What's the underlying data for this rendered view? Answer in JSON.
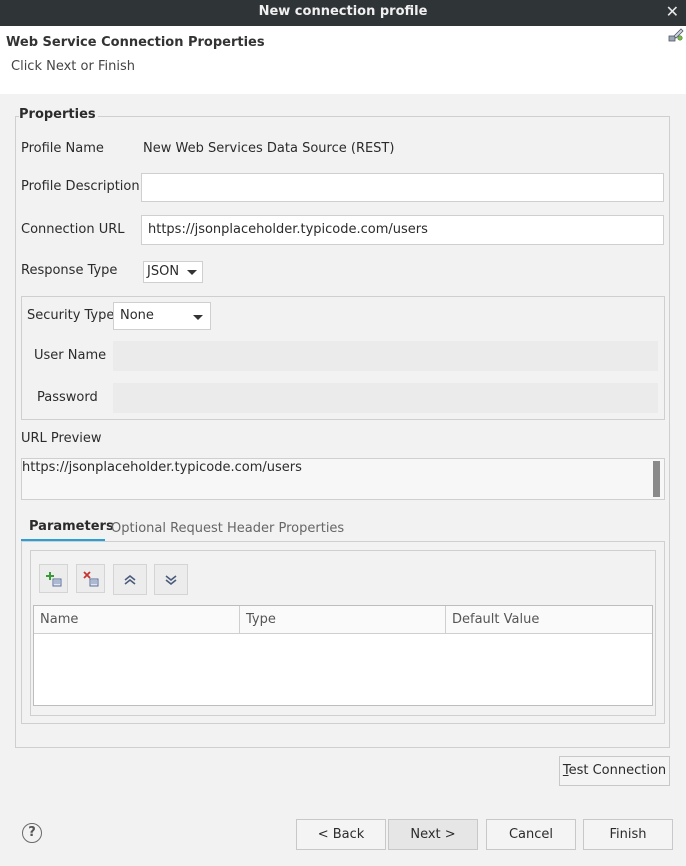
{
  "window": {
    "title": "New connection profile"
  },
  "header": {
    "title": "Web Service Connection Properties",
    "subtitle": "Click Next or Finish"
  },
  "properties": {
    "group_label": "Properties",
    "profile_name_label": "Profile Name",
    "profile_name_value": "New Web Services Data Source (REST)",
    "profile_description_label": "Profile Description",
    "profile_description_value": "",
    "connection_url_label": "Connection URL",
    "connection_url_value": "https://jsonplaceholder.typicode.com/users",
    "response_type_label": "Response Type",
    "response_type_value": "JSON"
  },
  "security": {
    "type_label": "Security Type",
    "type_value": "None",
    "username_label": "User Name",
    "password_label": "Password"
  },
  "preview": {
    "label": "URL Preview",
    "value": "https://jsonplaceholder.typicode.com/users"
  },
  "tabs": [
    {
      "label": "Parameters",
      "active": true
    },
    {
      "label": "Optional Request Header Properties",
      "active": false
    }
  ],
  "parameters_table": {
    "columns": [
      "Name",
      "Type",
      "Default Value"
    ],
    "toolbar": [
      "add-parameter-icon",
      "remove-parameter-icon",
      "move-up-icon",
      "move-down-icon"
    ]
  },
  "buttons": {
    "test_connection_underline": "T",
    "test_connection_rest": "est Connection",
    "back": "< Back",
    "next": "Next >",
    "cancel": "Cancel",
    "finish": "Finish",
    "help": "?"
  },
  "colors": {
    "accent": "#2a9fd6",
    "titlebar": "#2f3437"
  }
}
